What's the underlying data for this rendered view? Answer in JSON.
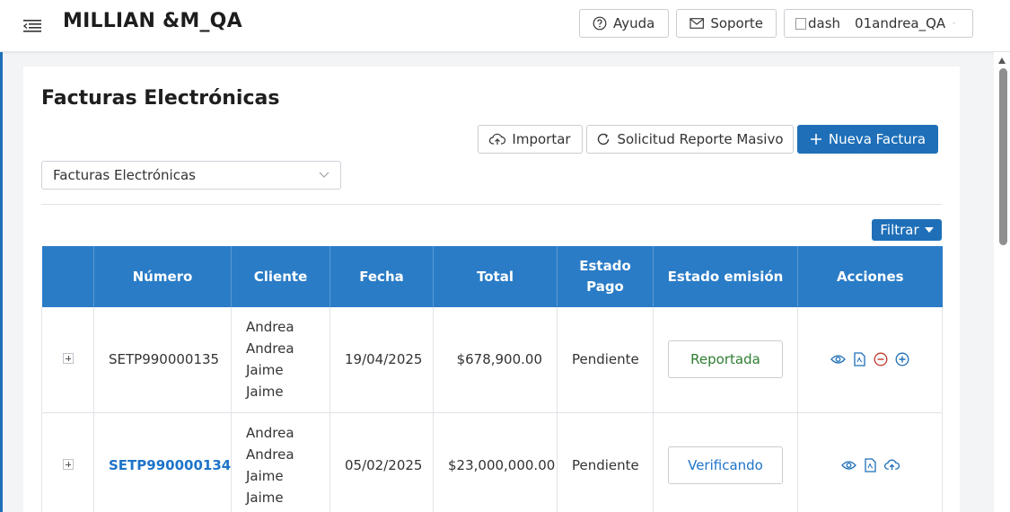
{
  "header": {
    "title": "MILLIAN &M_QA",
    "help_label": "Ayuda",
    "support_label": "Soporte",
    "user_img_alt": "dash",
    "user_name": "01andrea_QA"
  },
  "page": {
    "title": "Facturas Electrónicas",
    "import_label": "Importar",
    "bulk_report_label": "Solicitud Reporte Masivo",
    "new_invoice_label": "Nueva Factura",
    "doc_type_selected": "Facturas Electrónicas",
    "filter_label": "Filtrar"
  },
  "table": {
    "headers": [
      "",
      "Número",
      "Cliente",
      "Fecha",
      "Total",
      "Estado Pago",
      "Estado emisión",
      "Acciones"
    ],
    "rows": [
      {
        "numero": "SETP990000135",
        "cliente": "Andrea Andrea Jaime Jaime",
        "fecha": "19/04/2025",
        "total": "$678,900.00",
        "estado_pago": "Pendiente",
        "estado_emision": "Reportada"
      },
      {
        "numero": "SETP990000134",
        "cliente": "Andrea Andrea Jaime Jaime",
        "fecha": "05/02/2025",
        "total": "$23,000,000.00",
        "estado_pago": "Pendiente",
        "estado_emision": "Verificando"
      }
    ]
  },
  "colors": {
    "primary": "#1e6fb8",
    "table_header": "#2a7cc7",
    "pending": "#c0392b",
    "reported": "#2e7d32",
    "link": "#1e74c9"
  }
}
